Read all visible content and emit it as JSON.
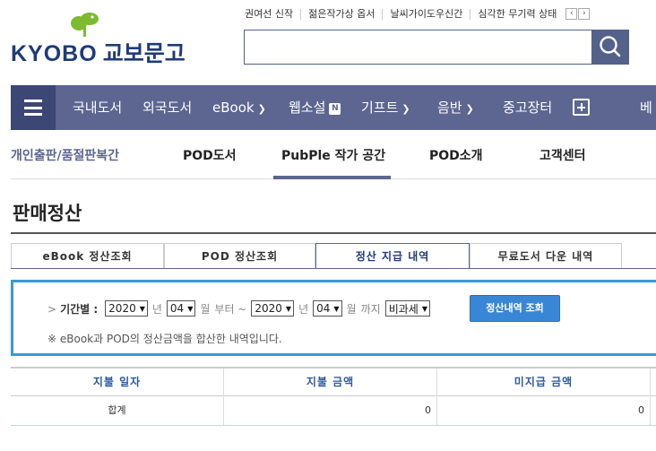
{
  "header": {
    "logo_text": "KYOBO",
    "logo_text_ko": "교보문고",
    "keywords": [
      "권여선 신작",
      "젊은작가상 옵서",
      "날씨가이도우신간",
      "심각한 무기력 상태"
    ],
    "search_placeholder": ""
  },
  "nav": {
    "items": [
      {
        "label": "국내도서"
      },
      {
        "label": "외국도서"
      },
      {
        "label": "eBook"
      },
      {
        "label": "웹소설",
        "badge": "N"
      },
      {
        "label": "기프트"
      },
      {
        "label": "음반"
      },
      {
        "label": "중고장터"
      }
    ],
    "overflow_label": "베 스"
  },
  "subnav": {
    "section_title": "개인출판/품절판복간",
    "items": [
      "POD도서",
      "PubPle 작가 공간",
      "POD소개",
      "고객센터"
    ],
    "active": "PubPle 작가 공간"
  },
  "page_title": "판매정산",
  "tabs": [
    "eBook 정산조회",
    "POD 정산조회",
    "정산 지급 내역",
    "무료도서 다운 내역"
  ],
  "active_tab": "정산 지급 내역",
  "filter": {
    "label": "기간별 :",
    "start_year": "2020",
    "start_month": "04",
    "start_suffix": "부터 ~",
    "end_year": "2020",
    "end_month": "04",
    "end_suffix": "까지",
    "year_unit": "년",
    "month_unit": "월",
    "tax_option": "비과세",
    "query_button": "정산내역 조회",
    "note": "※ eBook과 POD의 정산금액을 합산한 내역입니다."
  },
  "table": {
    "headers": [
      "지불 일자",
      "지불 금액",
      "미지급 금액"
    ],
    "rows": [
      {
        "date": "합계",
        "paid": "0",
        "unpaid": "0"
      }
    ]
  },
  "colors": {
    "brand_navy": "#1f3a78",
    "nav_bg": "#5c6690",
    "filter_border": "#3a9ad9",
    "query_button": "#3a86d6",
    "logo_green": "#7dba2f"
  }
}
